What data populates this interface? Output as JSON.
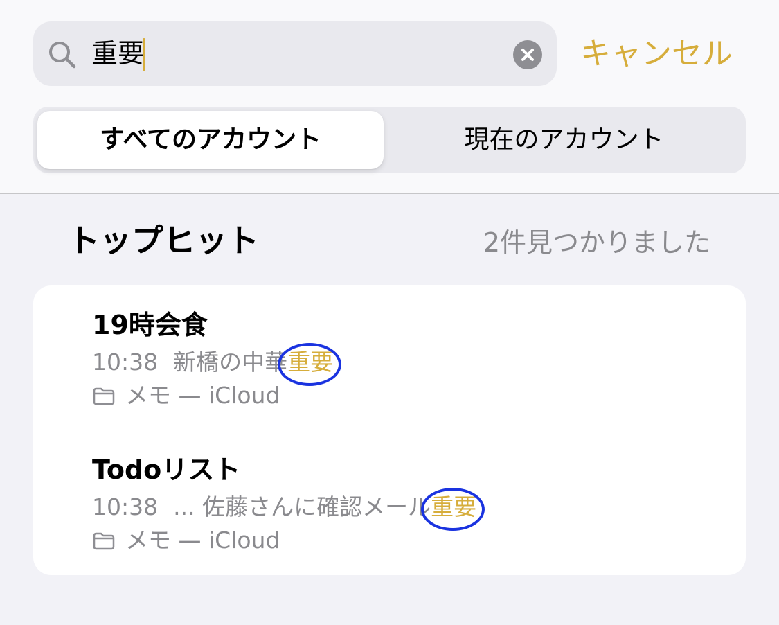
{
  "search": {
    "query": "重要",
    "cancel_label": "キャンセル"
  },
  "segments": {
    "selected": "すべてのアカウント",
    "other": "現在のアカウント"
  },
  "section": {
    "title": "トップヒット",
    "count": "2件見つかりました"
  },
  "results": [
    {
      "title": "19時会食",
      "time": "10:38",
      "snippet": "新橋の中華",
      "highlight": "重要",
      "folder": "メモ — iCloud"
    },
    {
      "title": "Todoリスト",
      "time": "10:38",
      "snippet": "... 佐藤さんに確認メール",
      "highlight": "重要",
      "folder": "メモ — iCloud"
    }
  ],
  "colors": {
    "accent": "#d6ad3b",
    "annotation": "#1a33e0"
  }
}
